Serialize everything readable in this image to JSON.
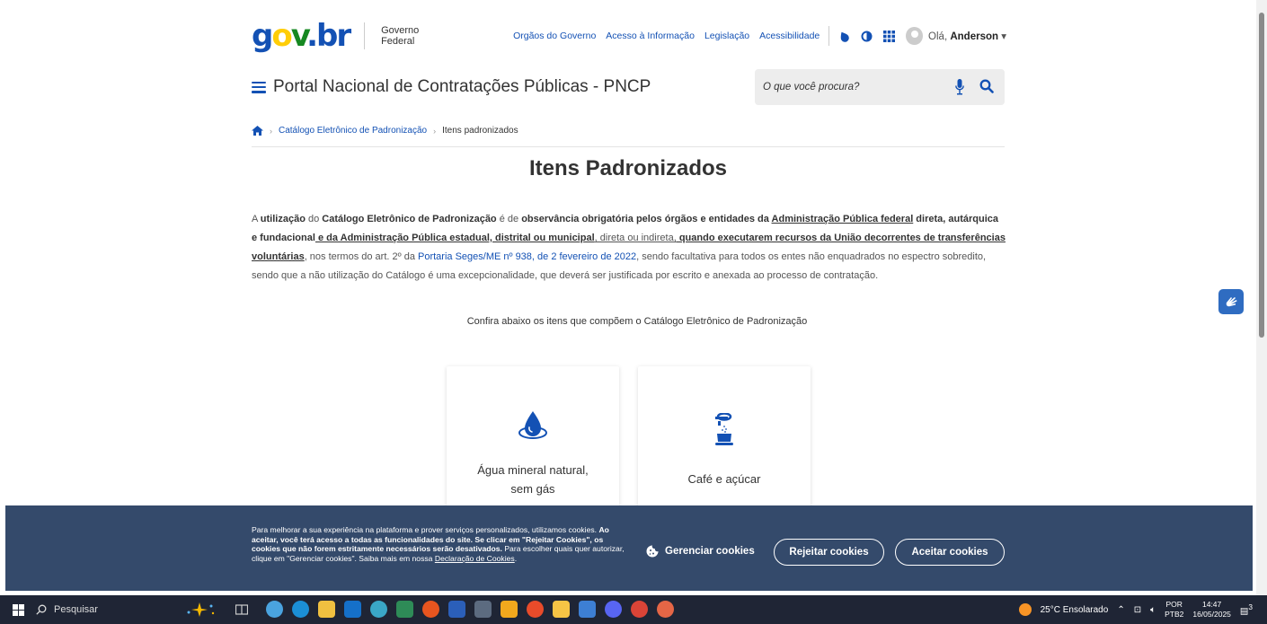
{
  "header": {
    "logo": {
      "g": "g",
      "o": "o",
      "v": "v",
      "dot": ".",
      "br": "br"
    },
    "gov_federal": "Governo Federal",
    "links": [
      "Orgãos do Governo",
      "Acesso à Informação",
      "Legislação",
      "Acessibilidade"
    ],
    "greeting_prefix": "Olá, ",
    "user_name": "Anderson"
  },
  "portal": {
    "title": "Portal Nacional de Contratações Públicas - PNCP",
    "search_placeholder": "O que você procura?"
  },
  "breadcrumb": {
    "link": "Catálogo Eletrônico de Padronização",
    "current": "Itens padronizados"
  },
  "page": {
    "title": "Itens Padronizados",
    "intro": {
      "p1": "A ",
      "p2": "utilização",
      "p3": " do ",
      "p4": "Catálogo Eletrônico de Padronização",
      "p5": " é de ",
      "p6": "observância obrigatória pelos órgãos e entidades da ",
      "p7": "Administração Pública federal",
      "p8": " direta, autárquica e fundacional",
      "p9": " e da Administração Pública estadual, distrital ou municipal",
      "p10": ", direta ou indireta,",
      "p11": " quando executarem recursos da União decorrentes de transferências voluntárias",
      "p12": ", nos termos do art. 2º da ",
      "p13": "Portaria Seges/ME nº 938, de 2 fevereiro de 2022",
      "p14": ", sendo facultativa para todos os entes não enquadrados no espectro sobredito, sendo que a não utilização do Catálogo é uma excepcionalidade, que deverá ser justificada por escrito e anexada ao processo de contratação."
    },
    "confira": "Confira abaixo os itens que compõem o Catálogo Eletrônico de Padronização",
    "cards": [
      {
        "label_line1": "Água mineral natural,",
        "label_line2": "sem gás",
        "icon": "water-drop-icon"
      },
      {
        "label_line1": "Café e açúcar",
        "icon": "coffee-icon"
      }
    ]
  },
  "cookie": {
    "t1": "Para melhorar a sua experiência na plataforma e prover serviços personalizados, utilizamos cookies. ",
    "t2": "Ao aceitar, você terá acesso a todas as funcionalidades do site. Se clicar em \"Rejeitar Cookies\", os cookies que não forem estritamente necessários serão desativados.",
    "t3": " Para escolher quais quer autorizar, clique em \"Gerenciar cookies\". Saiba mais em nossa ",
    "t4": "Declaração de Cookies",
    "t5": ".",
    "manage": "Gerenciar cookies",
    "reject": "Rejeitar cookies",
    "accept": "Aceitar cookies"
  },
  "taskbar": {
    "search": "Pesquisar",
    "weather": "25°C  Ensolarado",
    "lang1": "POR",
    "lang2": "PTB2",
    "time": "14:47",
    "date": "16/05/2025",
    "notif": "3"
  },
  "colors": {
    "primary": "#1351b4",
    "cookie_bg": "#344a6b",
    "taskbar_bg": "#1f2535"
  }
}
